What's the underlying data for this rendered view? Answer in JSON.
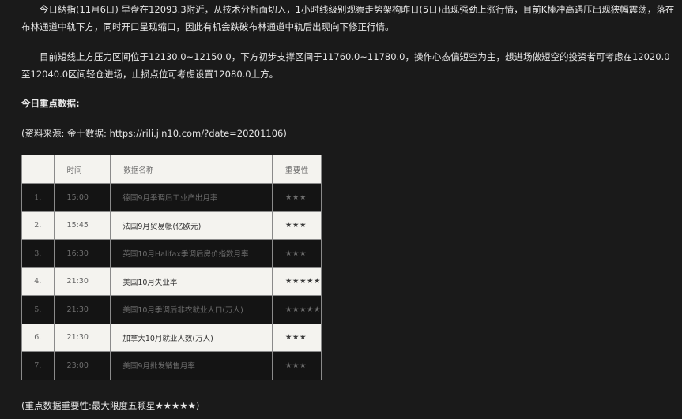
{
  "paragraphs": {
    "p1": "今日納指(11月6日) 早盘在12093.3附近，从技术分析面切入，1小时线级别观察走势架构昨日(5日)出现强劲上涨行情，目前K棒冲高遇压出现狭幅震荡，落在布林通道中轨下方，同时开口呈现缩口，因此有机会跌破布林通道中轨后出现向下修正行情。",
    "p2": "目前短线上方压力区间位于12130.0~12150.0，下方初步支撑区间于11760.0~11780.0，操作心态偏短空为主，想进场做短空的投资者可考虑在12020.0至12040.0区间轻仓进场，止损点位可考虑设置12080.0上方。"
  },
  "heading": "今日重点数据:",
  "source": "(资料来源: 金十数据: https://rili.jin10.com/?date=20201106)",
  "table": {
    "headers": [
      "",
      "时间",
      "数据名称",
      "重要性"
    ],
    "rows": [
      {
        "no": "1.",
        "time": "15:00",
        "name": "德国9月季调后工业产出月率",
        "importance": "★★★"
      },
      {
        "no": "2.",
        "time": "15:45",
        "name": "法国9月贸易帐(亿欧元)",
        "importance": "★★★"
      },
      {
        "no": "3.",
        "time": "16:30",
        "name": "英国10月Halifax季调后房价指数月率",
        "importance": "★★★"
      },
      {
        "no": "4.",
        "time": "21:30",
        "name": "美国10月失业率",
        "importance": "★★★★★"
      },
      {
        "no": "5.",
        "time": "21:30",
        "name": "美国10月季调后非农就业人口(万人)",
        "importance": "★★★★★"
      },
      {
        "no": "6.",
        "time": "21:30",
        "name": "加拿大10月就业人数(万人)",
        "importance": "★★★"
      },
      {
        "no": "7.",
        "time": "23:00",
        "name": "美国9月批发销售月率",
        "importance": "★★★"
      }
    ]
  },
  "footnote": "(重点数据重要性:最大限度五颗星★★★★★)"
}
